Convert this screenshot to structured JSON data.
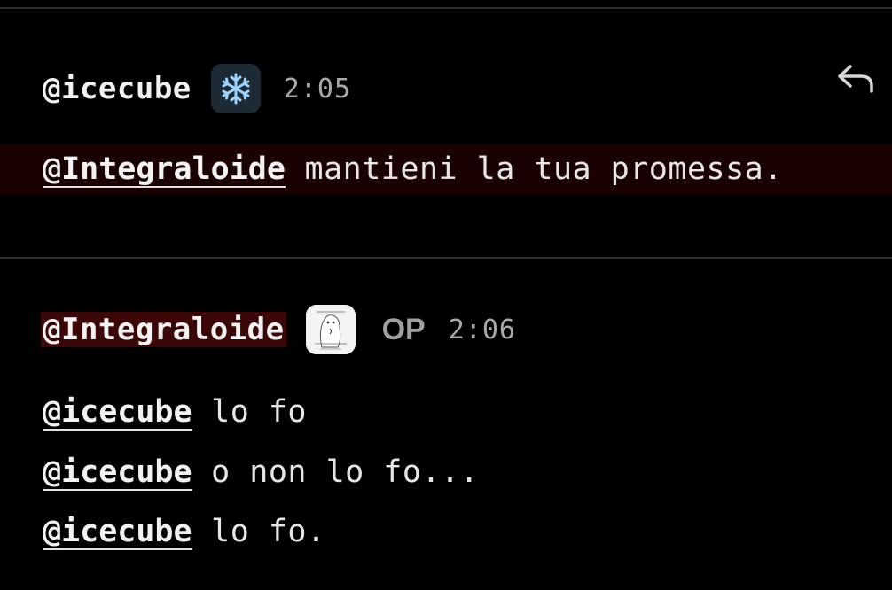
{
  "comments": [
    {
      "author": "@icecube",
      "avatar_icon": "snowflake-icon",
      "time": "2:05",
      "lines": [
        {
          "mention": "@Integraloide",
          "text": " mantieni la tua promessa."
        }
      ]
    },
    {
      "author": "@Integraloide",
      "avatar_icon": "cat-sticker-avatar",
      "badge": "OP",
      "time": "2:06",
      "lines": [
        {
          "mention": "@icecube",
          "text": " lo fo"
        },
        {
          "mention": "@icecube",
          "text": " o non lo fo..."
        },
        {
          "mention": "@icecube",
          "text": " lo fo."
        }
      ]
    }
  ],
  "colors": {
    "background": "#000000",
    "highlight": "#3a0606",
    "quoted_row": "#1a0203",
    "divider": "#2c2c2c"
  }
}
